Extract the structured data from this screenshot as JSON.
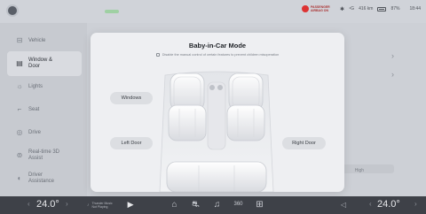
{
  "status_bar": {
    "airbag_text": "PASSENGER AIRBAG ON",
    "signal": "⁴G",
    "range": "416 km",
    "battery_pct": "87%",
    "time": "18:44"
  },
  "sidebar": {
    "items": [
      {
        "label": "Vehicle",
        "icon": "car-icon"
      },
      {
        "label": "Window & Door",
        "icon": "window-door-icon"
      },
      {
        "label": "Lights",
        "icon": "lights-icon"
      },
      {
        "label": "Seat",
        "icon": "seat-icon"
      },
      {
        "label": "Drive",
        "icon": "drive-icon"
      },
      {
        "label": "Real-time 3D Assist",
        "icon": "3d-assist-icon"
      },
      {
        "label": "Driver Assistance",
        "icon": "driver-assist-icon"
      }
    ],
    "active_index": 1
  },
  "content": {
    "hi_label": "High"
  },
  "modal": {
    "title": "Baby-in-Car Mode",
    "subtitle": "Disable the manual control of certain features to prevent children misoperation",
    "buttons": {
      "windows": "Windows",
      "left_door": "Left Door",
      "right_door": "Right Door"
    }
  },
  "dock": {
    "left_temp": "24.0°",
    "right_temp": "24.0°",
    "media_title": "Thunder Music",
    "media_sub": "Not Playing",
    "icons": [
      "home-icon",
      "car-icon",
      "music-icon",
      "360-icon",
      "apps-icon"
    ]
  },
  "colors": {
    "modal_bg": "#eeeff2",
    "dock_bg": "#3e4148",
    "airbag_red": "#d33333"
  }
}
